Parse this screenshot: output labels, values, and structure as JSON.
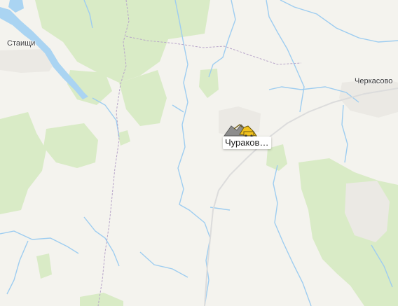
{
  "map": {
    "colors": {
      "land": "#f4f3ee",
      "forest": "#d9ebc6",
      "forest_dark": "#cfe5b8",
      "water": "#aad4f2",
      "stream": "#9ecdf0",
      "settlement": "#ebe9e4",
      "boundary": "#b7a4c9",
      "road": "#d9d9d9",
      "poi_icon": "#f2c21b"
    },
    "places": [
      {
        "id": "staitsi",
        "name": "Стаищи"
      },
      {
        "id": "cherkasovo",
        "name": "Черкасово"
      }
    ],
    "poi": {
      "name": "Чураков…",
      "icon": "quarry-icon"
    }
  }
}
